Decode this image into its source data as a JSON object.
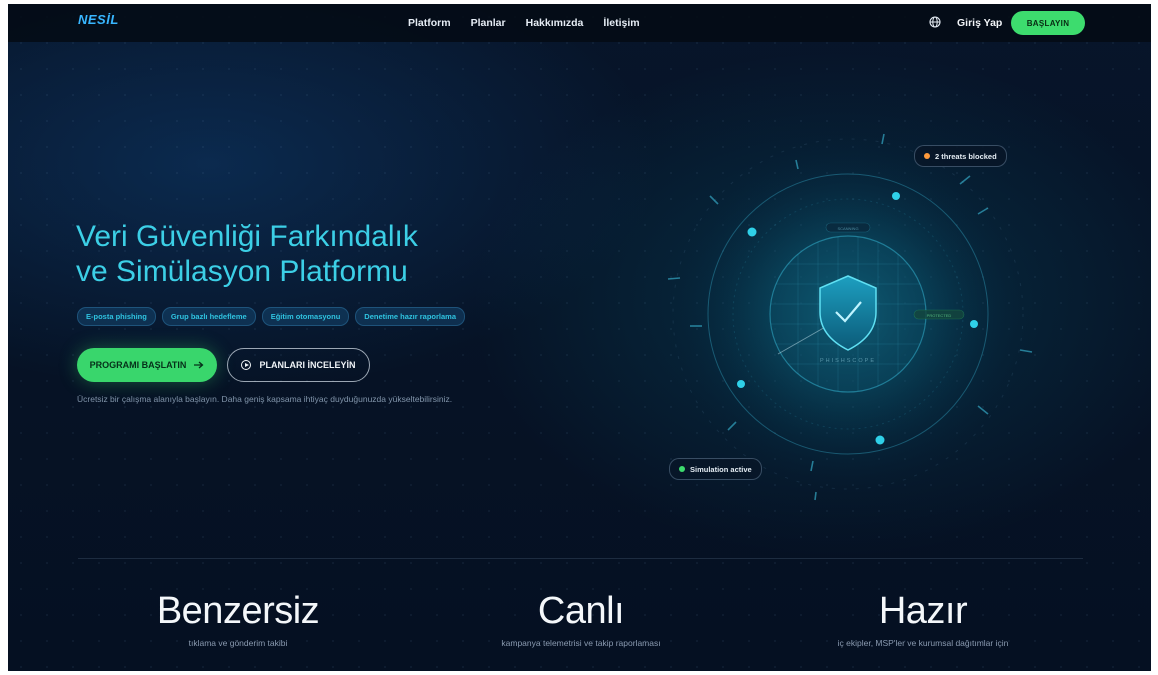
{
  "nav": {
    "logo": "NESİL",
    "items": [
      "Platform",
      "Planlar",
      "Hakkımızda",
      "İletişim"
    ],
    "language_icon": "globe-icon",
    "login": "Giriş Yap",
    "cta": "BAŞLAYIN"
  },
  "hero": {
    "title_line1": "Veri Güvenliği Farkındalık",
    "title_line2": "ve Simülasyon Platformu",
    "tags": [
      "E-posta phishing",
      "Grup bazlı hedefleme",
      "Eğitim otomasyonu",
      "Denetime hazır raporlama"
    ],
    "primary_cta": "PROGRAMI BAŞLATIN",
    "primary_cta_icon": "arrow-right-icon",
    "secondary_cta": "PLANLARI İNCELEYİN",
    "secondary_cta_icon": "play-circle-icon",
    "note": "Ücretsiz bir çalışma alanıyla başlayın. Daha geniş kapsama ihtiyaç duyduğunuzda yükseltebilirsiniz."
  },
  "visual": {
    "badge_threats": "2 threats blocked",
    "badge_simulation": "Simulation active",
    "shield_label": "PHISHSCOPE",
    "ring_label_top": "SCANNING",
    "ring_label_right": "PROTECTED",
    "colors": {
      "accent": "#2fd0e8",
      "green": "#3ddc6e",
      "orange": "#ff9a3c"
    }
  },
  "stats": [
    {
      "value": "Benzersiz",
      "caption": "tıklama ve gönderim takibi"
    },
    {
      "value": "Canlı",
      "caption": "kampanya telemetrisi ve takip raporlaması"
    },
    {
      "value": "Hazır",
      "caption": "iç ekipler, MSP'ler ve kurumsal dağıtımlar için"
    }
  ]
}
